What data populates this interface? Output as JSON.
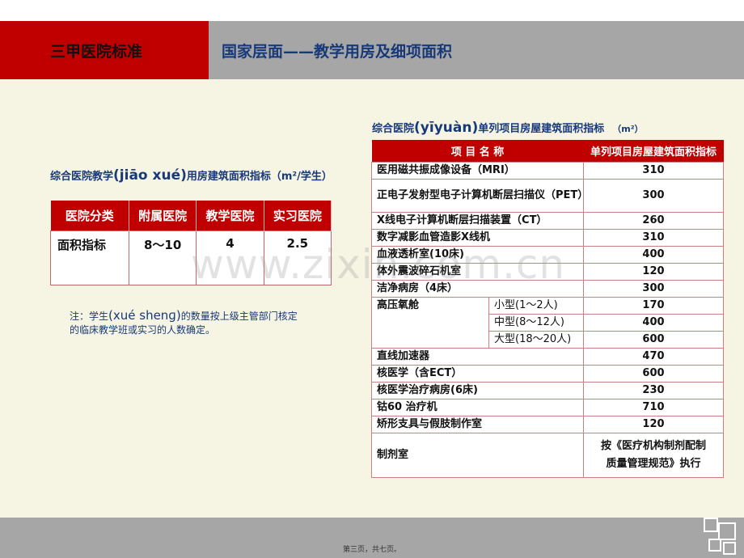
{
  "header": {
    "left_title": "三甲医院标准",
    "right_title": "国家层面——教学用房及细项面积"
  },
  "left": {
    "title_part1": "综合医院教学",
    "title_pinyin": "(jiāo xué)",
    "title_part2": "用房建筑面积指标（m²/学生）",
    "columns": [
      "医院分类",
      "附属医院",
      "教学医院",
      "实习医院"
    ],
    "row": [
      "面积指标",
      "8～10",
      "4",
      "2.5"
    ],
    "note_part1": "注：学生",
    "note_pinyin": "(xué shenɡ)",
    "note_part2": "的数量按上级主管部门核定的临床教学班或实习的人数确定。"
  },
  "right": {
    "title_part1": "综合医院",
    "title_pinyin": "(yīyuàn)",
    "title_part2": "单列项目房屋建筑面积指标",
    "unit": "（m²）",
    "columns": [
      "项 目 名 称",
      "单列项目房屋建筑面积指标"
    ],
    "rows": [
      {
        "name": "医用磁共振成像设备（MRI）",
        "value": "310"
      },
      {
        "name": "正电子发射型电子计算机断层扫描仪（PET）",
        "value": "300"
      },
      {
        "name": "X线电子计算机断层扫描装置（CT）",
        "value": "260"
      },
      {
        "name": "数字减影血管造影X线机",
        "value": "310"
      },
      {
        "name": "血液透析室(10床)",
        "value": "400"
      },
      {
        "name": "体外震波碎石机室",
        "value": "120"
      },
      {
        "name": "洁净病房（4床）",
        "value": "300"
      }
    ],
    "oxygen": {
      "name": "高压氧舱",
      "sub": [
        {
          "name": "小型(1～2人)",
          "value": "170"
        },
        {
          "name": "中型(8～12人)",
          "value": "400"
        },
        {
          "name": "大型(18～20人)",
          "value": "600"
        }
      ]
    },
    "rows2": [
      {
        "name": "直线加速器",
        "value": "470"
      },
      {
        "name": "核医学（含ECT）",
        "value": "600"
      },
      {
        "name": "核医学治疗病房(6床)",
        "value": "230"
      },
      {
        "name": "钴60 治疗机",
        "value": "710"
      },
      {
        "name": "矫形支具与假肢制作室",
        "value": "120"
      }
    ],
    "last": {
      "name": "制剂室",
      "value_line1": "按《医疗机构制剂配制",
      "value_line2": "质量管理规范》执行"
    }
  },
  "watermark": "www.zixin.com.cn",
  "footer": {
    "page": "第三页，共七页。"
  },
  "colors": {
    "header_red": "#c00000",
    "header_gray": "#a6a6a6",
    "title_blue": "#17397a",
    "background": "#f6f4e2"
  }
}
